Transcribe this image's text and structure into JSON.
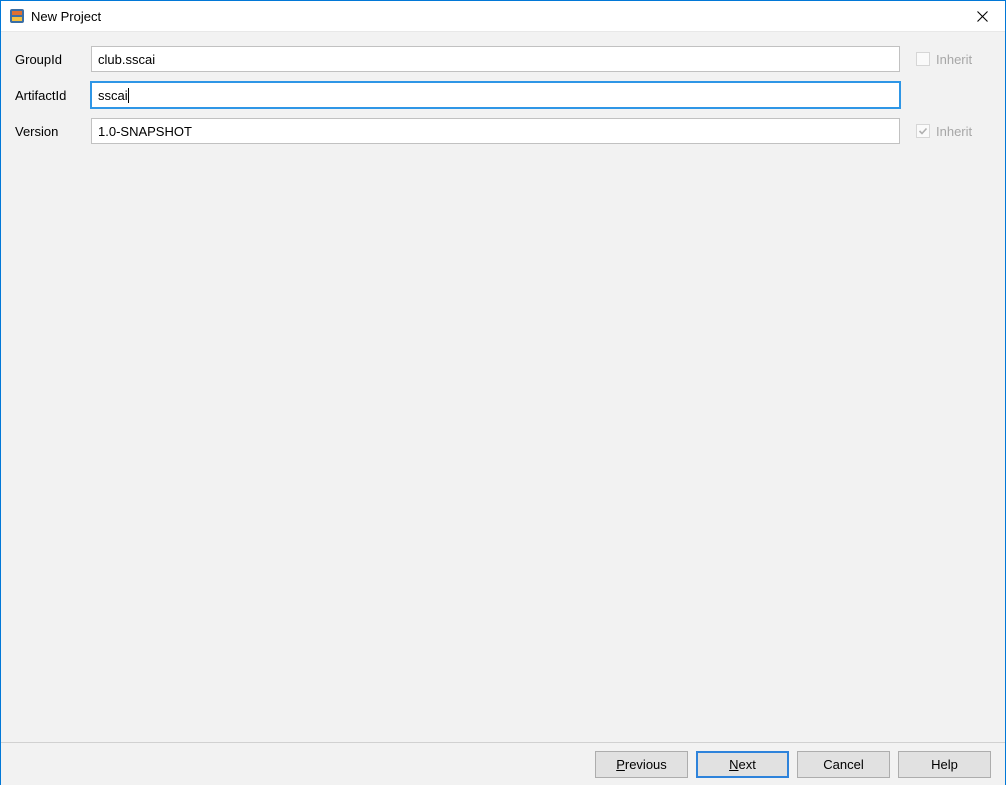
{
  "window": {
    "title": "New Project"
  },
  "form": {
    "groupid": {
      "label": "GroupId",
      "value": "club.sscai",
      "inherit_label": "Inherit",
      "inherit_checked": false,
      "inherit_enabled": false
    },
    "artifactid": {
      "label": "ArtifactId",
      "value": "sscai"
    },
    "version": {
      "label": "Version",
      "value": "1.0-SNAPSHOT",
      "inherit_label": "Inherit",
      "inherit_checked": true,
      "inherit_enabled": false
    }
  },
  "buttons": {
    "previous": "Previous",
    "next": "Next",
    "cancel": "Cancel",
    "help": "Help"
  }
}
